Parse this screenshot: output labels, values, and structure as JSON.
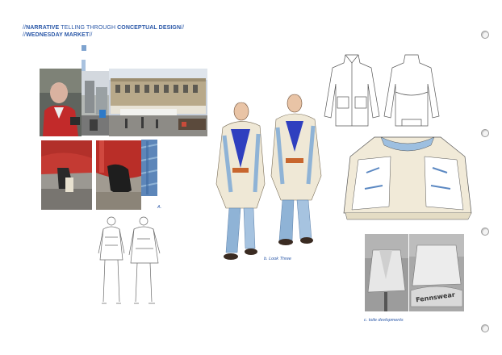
{
  "header": {
    "line1": {
      "prefix": "//",
      "bold1": "NARRATIVE",
      "middle": " TELLING THROUGH ",
      "bold2": "CONCEPTUAL DESIGN",
      "suffix": "//"
    },
    "line2": {
      "prefix": "//",
      "bold": "WEDNESDAY MARKET",
      "suffix": "//"
    }
  },
  "captions": {
    "a": "A.",
    "b": "b. Look Three",
    "c": "c. toile devlopments"
  },
  "toile_print": "Fennswear",
  "colors": {
    "accent_blue": "#2b58a8",
    "denim": "#8fb3d6",
    "red_jacket": "#b8322c",
    "cream": "#efe8d6"
  }
}
